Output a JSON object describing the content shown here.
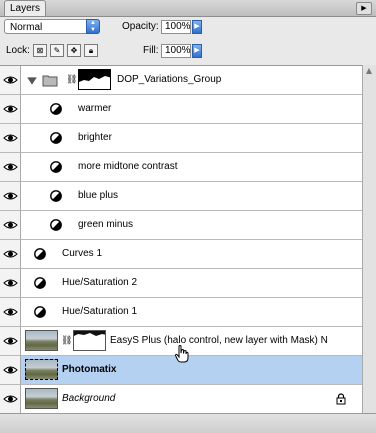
{
  "panel": {
    "tab_label": "Layers",
    "menu_icon": "panel-menu-icon"
  },
  "options": {
    "blend_mode": "Normal",
    "opacity_label": "Opacity:",
    "opacity_value": "100%",
    "lock_label": "Lock:",
    "fill_label": "Fill:",
    "fill_value": "100%"
  },
  "layers": [
    {
      "name": "DOP_Variations_Group",
      "type": "group"
    },
    {
      "name": "warmer",
      "type": "adjustment",
      "indent": true
    },
    {
      "name": "brighter",
      "type": "adjustment",
      "indent": true
    },
    {
      "name": "more midtone contrast",
      "type": "adjustment",
      "indent": true
    },
    {
      "name": "blue plus",
      "type": "adjustment",
      "indent": true
    },
    {
      "name": "green minus",
      "type": "adjustment",
      "indent": true
    },
    {
      "name": "Curves 1",
      "type": "adjustment"
    },
    {
      "name": "Hue/Saturation 2",
      "type": "adjustment"
    },
    {
      "name": "Hue/Saturation 1",
      "type": "adjustment"
    },
    {
      "name": "EasyS Plus    (halo control, new layer with Mask) N",
      "type": "image-mask"
    },
    {
      "name": "Photomatix",
      "type": "image",
      "selected": true
    },
    {
      "name": "Background",
      "type": "background",
      "locked": true
    }
  ],
  "colors": {
    "selected_row": "#b5d1f1",
    "arrow_blue": "#2e6fd0"
  }
}
